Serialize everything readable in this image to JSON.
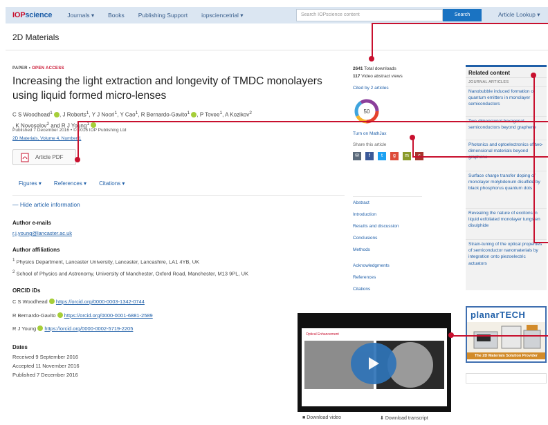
{
  "nav": {
    "logo_a": "IOP",
    "logo_b": "science",
    "links": [
      "Journals ▾",
      "Books",
      "Publishing Support",
      "iopsciencetrial ▾"
    ],
    "search_placeholder": "Search IOPscience content",
    "search_button": "Search",
    "article_lookup": "Article Lookup ▾"
  },
  "journal_title": "2D Materials",
  "article": {
    "type_prefix": "PAPER • ",
    "type_oa": "OPEN ACCESS",
    "title": "Increasing the light extraction and longevity of TMDC monolayers using liquid formed micro-lenses",
    "authors_line1": "C S Woodhead",
    "authors_line1b": ", J Roberts",
    "authors_line1c": ", Y J Noori",
    "authors_line1d": ", Y Cao",
    "authors_line1e": ", R Bernardo-Gavito",
    "authors_line1f": ", P Tovee",
    "authors_line1g": ", A Kozikov",
    "authors_line2": ", K Novoselov",
    "authors_line2b": " and R J Young",
    "published": "Published 7 December 2016 • © 2016 IOP Publishing Ltd",
    "volume": "2D Materials, Volume 4, Number 1",
    "pdf_label": "Article PDF"
  },
  "tabs": [
    "Figures ▾",
    "References ▾",
    "Citations ▾"
  ],
  "hide_info": "— Hide article information",
  "author_emails": {
    "heading": "Author e-mails",
    "email": "r.j.young@lancaster.ac.uk"
  },
  "affiliations": {
    "heading": "Author affiliations",
    "a1": "Physics Department, Lancaster University, Lancaster, Lancashire, LA1 4YB, UK",
    "a2": "School of Physics and Astronomy, University of Manchester, Oxford Road, Manchester, M13 9PL, UK"
  },
  "orcid": {
    "heading": "ORCID iDs",
    "rows": [
      {
        "name": "C S Woodhead",
        "url": "https://orcid.org/0000-0003-1342-0744"
      },
      {
        "name": "R Bernardo-Gavito",
        "url": "https://orcid.org/0000-0001-6881-2589"
      },
      {
        "name": "R J Young",
        "url": "https://orcid.org/0000-0002-5719-2205"
      }
    ]
  },
  "dates": {
    "heading": "Dates",
    "received": "Received 9 September 2016",
    "accepted": "Accepted 11 November 2016",
    "published": "Published 7 December 2016"
  },
  "metrics": {
    "downloads": "2641",
    "downloads_label": " Total downloads",
    "views": "117",
    "views_label": " Video abstract views",
    "cited": "Cited by 2 articles",
    "altmetric": "50",
    "turn_on": "Turn on MathJax",
    "share_label": "Share this article"
  },
  "toc": [
    "Abstract",
    "Introduction",
    "Results and discussion",
    "Conclusions",
    "Methods",
    "Acknowledgments",
    "References",
    "Citations"
  ],
  "related": {
    "heading": "Related content",
    "journal_label": "JOURNAL ARTICLES",
    "items": [
      "Nanobubble induced formation of quantum emitters in monolayer semiconductors",
      "Two-dimensional hexagonal semiconductors beyond graphene",
      "Photonics and optoelectronics of two-dimensional materials beyond graphene",
      "Surface charge transfer doping of monolayer molybdenum disulfide by black phosphorus quantum dots",
      "Revealing the nature of excitons in liquid exfoliated monolayer tungsten disulphide",
      "Strain-tuning of the optical properties of semiconductor nanomaterials by integration onto piezoelectric actuators"
    ]
  },
  "ad": {
    "brand": "planarTECH",
    "tagline": "The 2D Materials Solution Provider"
  },
  "video": {
    "slide_title": "Optical Enhancement",
    "download_video": "Download video",
    "download_transcript": "Download transcript"
  },
  "colors": {
    "accent": "#1f5fa8",
    "oa_red": "#c8102e",
    "annotation": "#c8102e"
  }
}
